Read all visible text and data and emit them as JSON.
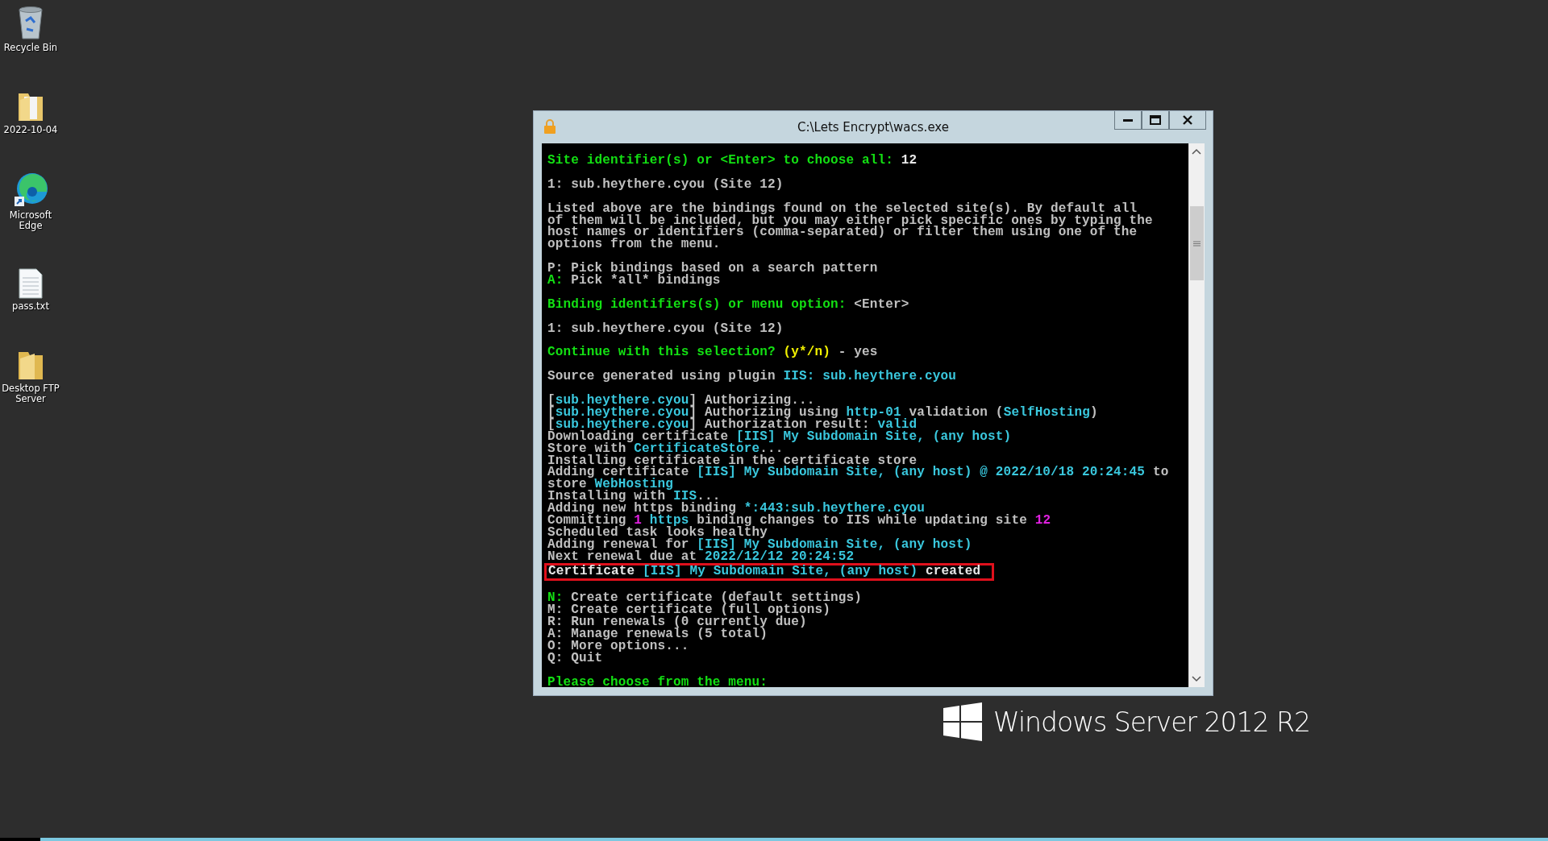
{
  "desktop_icons": [
    {
      "kind": "recycle-bin",
      "label": "Recycle Bin"
    },
    {
      "kind": "folder-docs",
      "label": "2022-10-04"
    },
    {
      "kind": "edge",
      "label": "Microsoft Edge"
    },
    {
      "kind": "text-file",
      "label": "pass.txt"
    },
    {
      "kind": "folder",
      "label": "Desktop FTP Server"
    }
  ],
  "window": {
    "title": "C:\\Lets Encrypt\\wacs.exe",
    "lines": [
      {
        "gap_before": false,
        "highlighted": false,
        "segments": [
          {
            "text": "Site identifier(s) or <Enter> to choose all:",
            "color": "#13e013"
          },
          {
            "text": " 12",
            "color": "#e8e8e8"
          }
        ]
      },
      {
        "gap_before": true,
        "highlighted": false,
        "segments": [
          {
            "text": "1: sub.heythere.cyou (Site 12)",
            "color": "#c0c0c0"
          }
        ]
      },
      {
        "gap_before": true,
        "highlighted": false,
        "segments": [
          {
            "text": "Listed above are the bindings found on the selected site(s). By default all",
            "color": "#c0c0c0"
          }
        ]
      },
      {
        "gap_before": false,
        "highlighted": false,
        "segments": [
          {
            "text": "of them will be included, but you may either pick specific ones by typing the",
            "color": "#c0c0c0"
          }
        ]
      },
      {
        "gap_before": false,
        "highlighted": false,
        "segments": [
          {
            "text": "host names or identifiers (comma-separated) or filter them using one of the",
            "color": "#c0c0c0"
          }
        ]
      },
      {
        "gap_before": false,
        "highlighted": false,
        "segments": [
          {
            "text": "options from the menu.",
            "color": "#c0c0c0"
          }
        ]
      },
      {
        "gap_before": true,
        "highlighted": false,
        "segments": [
          {
            "text": "P: Pick bindings based on a search pattern",
            "color": "#c0c0c0"
          }
        ]
      },
      {
        "gap_before": false,
        "highlighted": false,
        "segments": [
          {
            "text": "A:",
            "color": "#13e013"
          },
          {
            "text": " Pick *all* bindings",
            "color": "#c0c0c0"
          }
        ]
      },
      {
        "gap_before": true,
        "highlighted": false,
        "segments": [
          {
            "text": "Binding identifiers(s) or menu option:",
            "color": "#13e013"
          },
          {
            "text": " <Enter>",
            "color": "#c0c0c0"
          }
        ]
      },
      {
        "gap_before": true,
        "highlighted": false,
        "segments": [
          {
            "text": "1: sub.heythere.cyou (Site 12)",
            "color": "#c0c0c0"
          }
        ]
      },
      {
        "gap_before": true,
        "highlighted": false,
        "segments": [
          {
            "text": "Continue with this selection?",
            "color": "#13e013"
          },
          {
            "text": " (y*/n)",
            "color": "#f0f000"
          },
          {
            "text": " - yes",
            "color": "#c0c0c0"
          }
        ]
      },
      {
        "gap_before": true,
        "highlighted": false,
        "segments": [
          {
            "text": "Source generated using plugin ",
            "color": "#c0c0c0"
          },
          {
            "text": "IIS:",
            "color": "#3ac8de"
          },
          {
            "text": " sub.heythere.cyou",
            "color": "#3ac8de"
          }
        ]
      },
      {
        "gap_before": true,
        "highlighted": false,
        "segments": [
          {
            "text": "[",
            "color": "#c0c0c0"
          },
          {
            "text": "sub.heythere.cyou",
            "color": "#3ac8de"
          },
          {
            "text": "] Authorizing...",
            "color": "#c0c0c0"
          }
        ]
      },
      {
        "gap_before": false,
        "highlighted": false,
        "segments": [
          {
            "text": "[",
            "color": "#c0c0c0"
          },
          {
            "text": "sub.heythere.cyou",
            "color": "#3ac8de"
          },
          {
            "text": "] Authorizing using ",
            "color": "#c0c0c0"
          },
          {
            "text": "http-01",
            "color": "#3ac8de"
          },
          {
            "text": " validation (",
            "color": "#c0c0c0"
          },
          {
            "text": "SelfHosting",
            "color": "#3ac8de"
          },
          {
            "text": ")",
            "color": "#c0c0c0"
          }
        ]
      },
      {
        "gap_before": false,
        "highlighted": false,
        "segments": [
          {
            "text": "[",
            "color": "#c0c0c0"
          },
          {
            "text": "sub.heythere.cyou",
            "color": "#3ac8de"
          },
          {
            "text": "] Authorization result: ",
            "color": "#c0c0c0"
          },
          {
            "text": "valid",
            "color": "#3ac8de"
          }
        ]
      },
      {
        "gap_before": false,
        "highlighted": false,
        "segments": [
          {
            "text": "Downloading certificate ",
            "color": "#c0c0c0"
          },
          {
            "text": "[IIS] My Subdomain Site, (any host)",
            "color": "#3ac8de"
          }
        ]
      },
      {
        "gap_before": false,
        "highlighted": false,
        "segments": [
          {
            "text": "Store with ",
            "color": "#c0c0c0"
          },
          {
            "text": "CertificateStore",
            "color": "#3ac8de"
          },
          {
            "text": "...",
            "color": "#c0c0c0"
          }
        ]
      },
      {
        "gap_before": false,
        "highlighted": false,
        "segments": [
          {
            "text": "Installing certificate in the certificate store",
            "color": "#c0c0c0"
          }
        ]
      },
      {
        "gap_before": false,
        "highlighted": false,
        "segments": [
          {
            "text": "Adding certificate ",
            "color": "#c0c0c0"
          },
          {
            "text": "[IIS] My Subdomain Site, (any host) @ 2022/10/18 20:24:45",
            "color": "#3ac8de"
          },
          {
            "text": " to",
            "color": "#c0c0c0"
          }
        ]
      },
      {
        "gap_before": false,
        "highlighted": false,
        "segments": [
          {
            "text": "store ",
            "color": "#c0c0c0"
          },
          {
            "text": "WebHosting",
            "color": "#3ac8de"
          }
        ]
      },
      {
        "gap_before": false,
        "highlighted": false,
        "segments": [
          {
            "text": "Installing with ",
            "color": "#c0c0c0"
          },
          {
            "text": "IIS",
            "color": "#3ac8de"
          },
          {
            "text": "...",
            "color": "#c0c0c0"
          }
        ]
      },
      {
        "gap_before": false,
        "highlighted": false,
        "segments": [
          {
            "text": "Adding new https binding ",
            "color": "#c0c0c0"
          },
          {
            "text": "*:443:sub.heythere.cyou",
            "color": "#3ac8de"
          }
        ]
      },
      {
        "gap_before": false,
        "highlighted": false,
        "segments": [
          {
            "text": "Committing ",
            "color": "#c0c0c0"
          },
          {
            "text": "1",
            "color": "#e020e0"
          },
          {
            "text": " https",
            "color": "#3ac8de"
          },
          {
            "text": " binding changes to IIS while updating site ",
            "color": "#c0c0c0"
          },
          {
            "text": "12",
            "color": "#e020e0"
          }
        ]
      },
      {
        "gap_before": false,
        "highlighted": false,
        "segments": [
          {
            "text": "Scheduled task looks healthy",
            "color": "#c0c0c0"
          }
        ]
      },
      {
        "gap_before": false,
        "highlighted": false,
        "segments": [
          {
            "text": "Adding renewal for ",
            "color": "#c0c0c0"
          },
          {
            "text": "[IIS] My Subdomain Site, (any host)",
            "color": "#3ac8de"
          }
        ]
      },
      {
        "gap_before": false,
        "highlighted": false,
        "segments": [
          {
            "text": "Next renewal due at ",
            "color": "#c0c0c0"
          },
          {
            "text": "2022/12/12 20:24:52",
            "color": "#3ac8de"
          }
        ]
      },
      {
        "gap_before": false,
        "highlighted": true,
        "segments": [
          {
            "text": "Certificate ",
            "color": "#e8e8e8"
          },
          {
            "text": "[IIS] My Subdomain Site, (any host)",
            "color": "#3ac8de"
          },
          {
            "text": " created",
            "color": "#e8e8e8"
          }
        ]
      },
      {
        "gap_before": true,
        "highlighted": false,
        "segments": [
          {
            "text": "N:",
            "color": "#13e013"
          },
          {
            "text": " Create certificate (default settings)",
            "color": "#c0c0c0"
          }
        ]
      },
      {
        "gap_before": false,
        "highlighted": false,
        "segments": [
          {
            "text": "M: Create certificate (full options)",
            "color": "#c0c0c0"
          }
        ]
      },
      {
        "gap_before": false,
        "highlighted": false,
        "segments": [
          {
            "text": "R: Run renewals (0 currently due)",
            "color": "#c0c0c0"
          }
        ]
      },
      {
        "gap_before": false,
        "highlighted": false,
        "segments": [
          {
            "text": "A: Manage renewals (5 total)",
            "color": "#c0c0c0"
          }
        ]
      },
      {
        "gap_before": false,
        "highlighted": false,
        "segments": [
          {
            "text": "O: More options...",
            "color": "#c0c0c0"
          }
        ]
      },
      {
        "gap_before": false,
        "highlighted": false,
        "segments": [
          {
            "text": "Q: Quit",
            "color": "#c0c0c0"
          }
        ]
      },
      {
        "gap_before": true,
        "highlighted": false,
        "segments": [
          {
            "text": "Please choose from the menu:",
            "color": "#13e013"
          }
        ]
      }
    ]
  },
  "brand": {
    "text": "Windows Server 2012 R2"
  }
}
